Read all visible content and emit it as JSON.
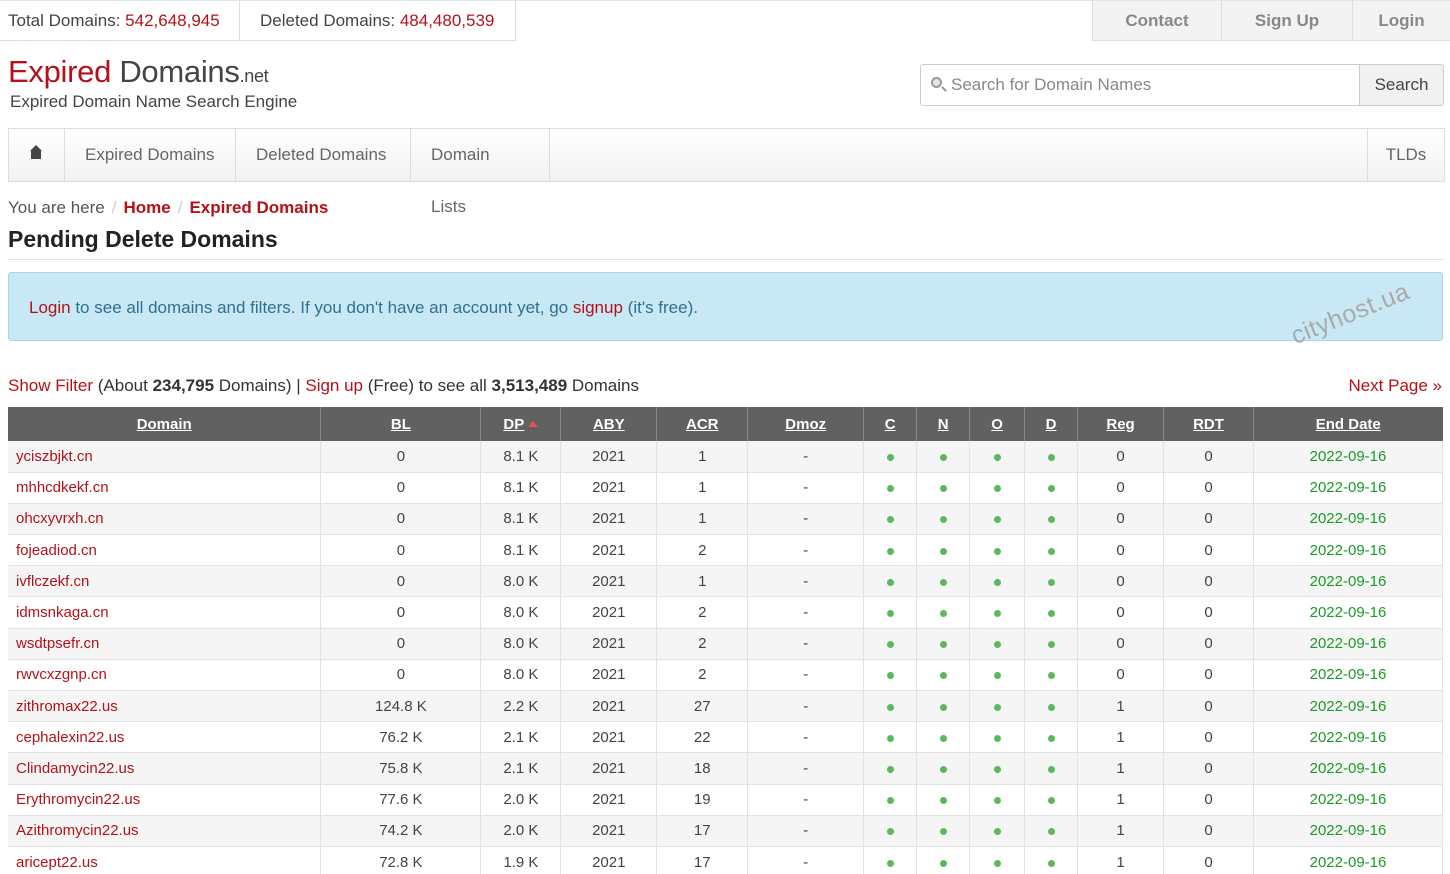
{
  "stats": {
    "total_label": "Total Domains: ",
    "total_value": "542,648,945",
    "deleted_label": "Deleted Domains: ",
    "deleted_value": "484,480,539"
  },
  "topnav": {
    "contact": "Contact",
    "signup": "Sign Up",
    "login": "Login"
  },
  "logo": {
    "part1": "Expired",
    "part2": " Domains",
    "part3": ".net",
    "tagline": "Expired Domain Name Search Engine"
  },
  "search": {
    "placeholder": "Search for Domain Names",
    "button": "Search"
  },
  "nav": {
    "expired": "Expired Domains",
    "deleted": "Deleted Domains",
    "lists": "Domain Lists",
    "tlds": "TLDs"
  },
  "breadcrumb": {
    "prefix": "You are here",
    "sep": "/",
    "home": "Home",
    "current": "Expired Domains"
  },
  "page_title": "Pending Delete Domains",
  "alert": {
    "login": "Login",
    "text1": " to see all domains and filters. If you don't have an account yet, go ",
    "signup": "signup",
    "text2": " (it's free)."
  },
  "watermark": "cityhost.ua",
  "filter": {
    "show_filter": "Show Filter",
    "about_prefix": " (About ",
    "about_count": "234,795",
    "about_suffix": " Domains) | ",
    "signup": "Sign up",
    "free_text": " (Free) to see all ",
    "total_count": "3,513,489",
    "total_suffix": " Domains",
    "next_page": "Next Page »"
  },
  "table": {
    "headers": [
      "Domain",
      "BL",
      "DP",
      "ABY",
      "ACR",
      "Dmoz",
      "C",
      "N",
      "O",
      "D",
      "Reg",
      "RDT",
      "End Date"
    ],
    "rows": [
      {
        "domain": "yciszbjkt.cn",
        "bl": "0",
        "dp": "8.1 K",
        "aby": "2021",
        "acr": "1",
        "dmoz": "-",
        "reg": "0",
        "rdt": "0",
        "end": "2022-09-16"
      },
      {
        "domain": "mhhcdkekf.cn",
        "bl": "0",
        "dp": "8.1 K",
        "aby": "2021",
        "acr": "1",
        "dmoz": "-",
        "reg": "0",
        "rdt": "0",
        "end": "2022-09-16"
      },
      {
        "domain": "ohcxyvrxh.cn",
        "bl": "0",
        "dp": "8.1 K",
        "aby": "2021",
        "acr": "1",
        "dmoz": "-",
        "reg": "0",
        "rdt": "0",
        "end": "2022-09-16"
      },
      {
        "domain": "fojeadiod.cn",
        "bl": "0",
        "dp": "8.1 K",
        "aby": "2021",
        "acr": "2",
        "dmoz": "-",
        "reg": "0",
        "rdt": "0",
        "end": "2022-09-16"
      },
      {
        "domain": "ivflczekf.cn",
        "bl": "0",
        "dp": "8.0 K",
        "aby": "2021",
        "acr": "1",
        "dmoz": "-",
        "reg": "0",
        "rdt": "0",
        "end": "2022-09-16"
      },
      {
        "domain": "idmsnkaga.cn",
        "bl": "0",
        "dp": "8.0 K",
        "aby": "2021",
        "acr": "2",
        "dmoz": "-",
        "reg": "0",
        "rdt": "0",
        "end": "2022-09-16"
      },
      {
        "domain": "wsdtpsefr.cn",
        "bl": "0",
        "dp": "8.0 K",
        "aby": "2021",
        "acr": "2",
        "dmoz": "-",
        "reg": "0",
        "rdt": "0",
        "end": "2022-09-16"
      },
      {
        "domain": "rwvcxzgnp.cn",
        "bl": "0",
        "dp": "8.0 K",
        "aby": "2021",
        "acr": "2",
        "dmoz": "-",
        "reg": "0",
        "rdt": "0",
        "end": "2022-09-16"
      },
      {
        "domain": "zithromax22.us",
        "bl": "124.8 K",
        "dp": "2.2 K",
        "aby": "2021",
        "acr": "27",
        "dmoz": "-",
        "reg": "1",
        "rdt": "0",
        "end": "2022-09-16"
      },
      {
        "domain": "cephalexin22.us",
        "bl": "76.2 K",
        "dp": "2.1 K",
        "aby": "2021",
        "acr": "22",
        "dmoz": "-",
        "reg": "1",
        "rdt": "0",
        "end": "2022-09-16"
      },
      {
        "domain": "Clindamycin22.us",
        "bl": "75.8 K",
        "dp": "2.1 K",
        "aby": "2021",
        "acr": "18",
        "dmoz": "-",
        "reg": "1",
        "rdt": "0",
        "end": "2022-09-16"
      },
      {
        "domain": "Erythromycin22.us",
        "bl": "77.6 K",
        "dp": "2.0 K",
        "aby": "2021",
        "acr": "19",
        "dmoz": "-",
        "reg": "1",
        "rdt": "0",
        "end": "2022-09-16"
      },
      {
        "domain": "Azithromycin22.us",
        "bl": "74.2 K",
        "dp": "2.0 K",
        "aby": "2021",
        "acr": "17",
        "dmoz": "-",
        "reg": "1",
        "rdt": "0",
        "end": "2022-09-16"
      },
      {
        "domain": "aricept22.us",
        "bl": "72.8 K",
        "dp": "1.9 K",
        "aby": "2021",
        "acr": "17",
        "dmoz": "-",
        "reg": "1",
        "rdt": "0",
        "end": "2022-09-16"
      }
    ]
  },
  "colors": {
    "brand_red": "#b3121a",
    "status_green": "#5cb85c",
    "date_green": "#1b9a27",
    "header_gray": "#616161"
  },
  "icons": {
    "home": "home-icon",
    "search": "magnifier-icon",
    "sort": "sort-up-icon",
    "status": "green-dot-icon"
  }
}
